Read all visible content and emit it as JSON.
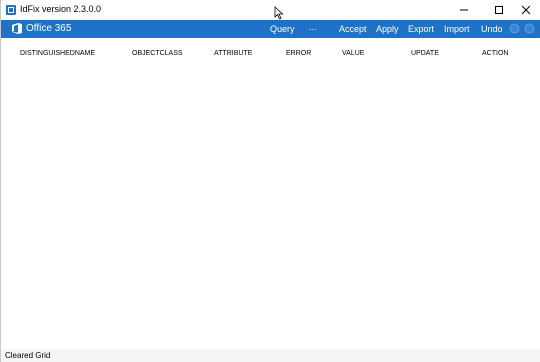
{
  "window": {
    "title": "IdFix version 2.3.0.0"
  },
  "ribbon": {
    "brand": "Office 365",
    "menu": {
      "query": "Query",
      "more": "...",
      "accept": "Accept",
      "apply": "Apply",
      "export": "Export",
      "import": "Import",
      "undo": "Undo"
    }
  },
  "grid": {
    "columns": [
      "DISTINGUISHEDNAME",
      "OBJECTCLASS",
      "ATTRIBUTE",
      "ERROR",
      "VALUE",
      "UPDATE",
      "ACTION"
    ],
    "rows": []
  },
  "status": {
    "text": "Cleared Grid"
  },
  "colors": {
    "ribbon": "#1e73c8",
    "ribbon_text": "#ffffff",
    "logo_orange": "#eb3c00"
  },
  "icons": {
    "app": "idfix-app-icon",
    "brand": "office-logo-icon",
    "minimize": "minimize-icon",
    "maximize": "maximize-icon",
    "close": "close-icon",
    "help": "circle-icon",
    "settings": "circle-icon",
    "cursor": "mouse-cursor-icon"
  }
}
